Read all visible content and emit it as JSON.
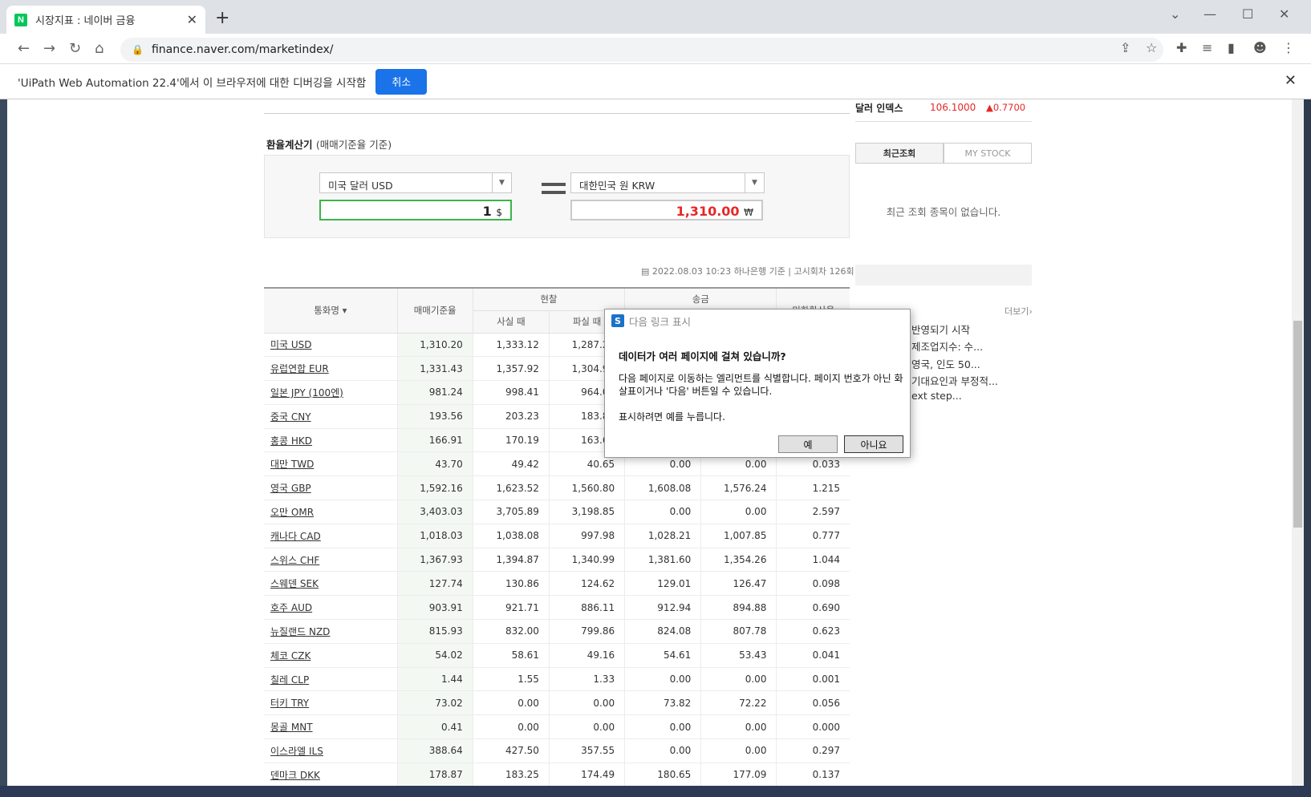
{
  "browser": {
    "tab_title": "시장지표 : 네이버 금융",
    "tab_favicon": "N",
    "url": "finance.naver.com/marketindex/"
  },
  "infobar": {
    "message": "'UiPath Web Automation 22.4'에서 이 브라우저에 대한 디버깅을 시작함",
    "cancel_label": "취소"
  },
  "calculator": {
    "title": "환율계산기",
    "title_note": "(매매기준율 기준)",
    "from_currency": "미국 달러 USD",
    "from_amount": "1",
    "from_unit": "$",
    "to_currency": "대한민국 원 KRW",
    "to_amount": "1,310.00",
    "to_unit": "₩"
  },
  "meta": {
    "date": "2022.08.03 10:23",
    "source": "하나은행 기준",
    "notice": "고시회차 126회"
  },
  "table": {
    "headers": {
      "currency": "통화명",
      "base": "매매기준율",
      "cash": "현찰",
      "cash_buy": "사실 때",
      "cash_sell": "파실 때",
      "transfer": "송금",
      "usd_rate": "미화환산율"
    },
    "rows": [
      {
        "name": "미국 USD",
        "base": "1,310.20",
        "buy": "1,333.12",
        "sell": "1,287.28",
        "send": "",
        "recv": "",
        "usd": ""
      },
      {
        "name": "유럽연합 EUR",
        "base": "1,331.43",
        "buy": "1,357.92",
        "sell": "1,304.94",
        "send": "",
        "recv": "",
        "usd": ""
      },
      {
        "name": "일본 JPY (100엔)",
        "base": "981.24",
        "buy": "998.41",
        "sell": "964.07",
        "send": "",
        "recv": "",
        "usd": ""
      },
      {
        "name": "중국 CNY",
        "base": "193.56",
        "buy": "203.23",
        "sell": "183.89",
        "send": "",
        "recv": "",
        "usd": ""
      },
      {
        "name": "홍콩 HKD",
        "base": "166.91",
        "buy": "170.19",
        "sell": "163.63",
        "send": "",
        "recv": "",
        "usd": ""
      },
      {
        "name": "대만 TWD",
        "base": "43.70",
        "buy": "49.42",
        "sell": "40.65",
        "send": "0.00",
        "recv": "0.00",
        "usd": "0.033"
      },
      {
        "name": "영국 GBP",
        "base": "1,592.16",
        "buy": "1,623.52",
        "sell": "1,560.80",
        "send": "1,608.08",
        "recv": "1,576.24",
        "usd": "1.215"
      },
      {
        "name": "오만 OMR",
        "base": "3,403.03",
        "buy": "3,705.89",
        "sell": "3,198.85",
        "send": "0.00",
        "recv": "0.00",
        "usd": "2.597"
      },
      {
        "name": "캐나다 CAD",
        "base": "1,018.03",
        "buy": "1,038.08",
        "sell": "997.98",
        "send": "1,028.21",
        "recv": "1,007.85",
        "usd": "0.777"
      },
      {
        "name": "스위스 CHF",
        "base": "1,367.93",
        "buy": "1,394.87",
        "sell": "1,340.99",
        "send": "1,381.60",
        "recv": "1,354.26",
        "usd": "1.044"
      },
      {
        "name": "스웨덴 SEK",
        "base": "127.74",
        "buy": "130.86",
        "sell": "124.62",
        "send": "129.01",
        "recv": "126.47",
        "usd": "0.098"
      },
      {
        "name": "호주 AUD",
        "base": "903.91",
        "buy": "921.71",
        "sell": "886.11",
        "send": "912.94",
        "recv": "894.88",
        "usd": "0.690"
      },
      {
        "name": "뉴질랜드 NZD",
        "base": "815.93",
        "buy": "832.00",
        "sell": "799.86",
        "send": "824.08",
        "recv": "807.78",
        "usd": "0.623"
      },
      {
        "name": "체코 CZK",
        "base": "54.02",
        "buy": "58.61",
        "sell": "49.16",
        "send": "54.61",
        "recv": "53.43",
        "usd": "0.041"
      },
      {
        "name": "칠레 CLP",
        "base": "1.44",
        "buy": "1.55",
        "sell": "1.33",
        "send": "0.00",
        "recv": "0.00",
        "usd": "0.001"
      },
      {
        "name": "터키 TRY",
        "base": "73.02",
        "buy": "0.00",
        "sell": "0.00",
        "send": "73.82",
        "recv": "72.22",
        "usd": "0.056"
      },
      {
        "name": "몽골 MNT",
        "base": "0.41",
        "buy": "0.00",
        "sell": "0.00",
        "send": "0.00",
        "recv": "0.00",
        "usd": "0.000"
      },
      {
        "name": "이스라엘 ILS",
        "base": "388.64",
        "buy": "427.50",
        "sell": "357.55",
        "send": "0.00",
        "recv": "0.00",
        "usd": "0.297"
      },
      {
        "name": "덴마크 DKK",
        "base": "178.87",
        "buy": "183.25",
        "sell": "174.49",
        "send": "180.65",
        "recv": "177.09",
        "usd": "0.137"
      }
    ]
  },
  "sidebar": {
    "dollar_index_label": "달러 인덱스",
    "dollar_index_value": "106.1000",
    "dollar_index_change": "▲0.7700",
    "tab_recent": "최근조회",
    "tab_mystock": "MY STOCK",
    "recent_empty": "최근 조회 종목이 없습니다.",
    "more": "더보기",
    "news": [
      "반영되기 시작",
      "제조업지수: 수...",
      "영국, 인도 50...",
      "기대요인과 부정적...",
      "ext step..."
    ]
  },
  "dialog": {
    "title": "다음 링크 표시",
    "heading": "데이터가 여러 페이지에 걸쳐 있습니까?",
    "body": "다음 페이지로 이동하는 엘리먼트를 식별합니다. 페이지 번호가 아닌 화살표이거나 '다음' 버튼일 수 있습니다.",
    "hint": "표시하려면 예를 누릅니다.",
    "yes": "예",
    "no": "아니요"
  },
  "colors": {
    "up": "#e52828",
    "accent": "#1a73e8",
    "green_box": "#3cb44a"
  }
}
